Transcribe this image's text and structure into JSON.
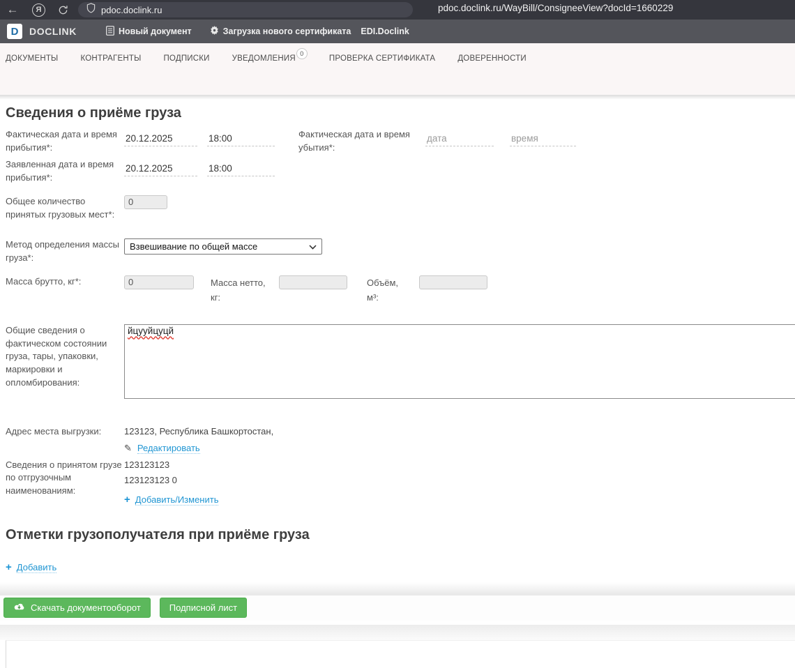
{
  "browser": {
    "url_domain": "pdoc.doclink.ru",
    "url_full": "pdoc.doclink.ru/WayBill/ConsigneeView?docId=1660229"
  },
  "header": {
    "brand": "DOCLINK",
    "logo_letter": "D",
    "menu": [
      {
        "label": "Новый документ"
      },
      {
        "label": "Загрузка нового сертификата"
      },
      {
        "label": "EDI.Doclink"
      }
    ]
  },
  "nav": {
    "tabs": [
      "ДОКУМЕНТЫ",
      "КОНТРАГЕНТЫ",
      "ПОДПИСКИ",
      "УВЕДОМЛЕНИЯ",
      "ПРОВЕРКА СЕРТИФИКАТА",
      "ДОВЕРЕННОСТИ"
    ],
    "notifications_badge": "0"
  },
  "cargo_section": {
    "title": "Сведения о приёме груза",
    "arrival_actual": {
      "label": "Фактическая дата и время прибытия*:",
      "date": "20.12.2025",
      "time": "18:00"
    },
    "departure_actual": {
      "label": "Фактическая дата и время убытия*:",
      "date_placeholder": "дата",
      "time_placeholder": "время"
    },
    "arrival_declared": {
      "label": "Заявленная дата и время прибытия*:",
      "date": "20.12.2025",
      "time": "18:00"
    },
    "total_places": {
      "label": "Общее количество принятых грузовых мест*:",
      "value": "0"
    },
    "mass_method": {
      "label": "Метод определения массы груза*:",
      "selected": "Взвешивание по общей массе"
    },
    "gross_mass": {
      "label": "Масса брутто, кг*:",
      "value": "0"
    },
    "net_mass": {
      "label": "Масса нетто, кг:",
      "value": ""
    },
    "volume": {
      "label": "Объём, м³:",
      "value": ""
    },
    "condition": {
      "label": "Общие сведения о фактическом состоянии груза, тары, упаковки, маркировки и опломбирования:",
      "value": "йцууйцуцй"
    },
    "unload_address": {
      "label": "Адрес места выгрузки:",
      "value": "123123, Республика Башкортостан,",
      "edit_link": "Редактировать"
    },
    "accepted_cargo": {
      "label": "Сведения о принятом грузе по отгрузочным наименованиям:",
      "lines": [
        "123123123",
        "123123123 0"
      ],
      "link": "Добавить/Изменить"
    }
  },
  "marks_section": {
    "title": "Отметки грузополучателя при приёме груза",
    "add_link": "Добавить"
  },
  "footer": {
    "buttons": [
      {
        "label": "Скачать документооборот"
      },
      {
        "label": "Подписной лист"
      }
    ]
  },
  "colors": {
    "link_blue": "#2196d3",
    "button_green": "#5cb85c",
    "header_gray": "#54555b",
    "browser_dark": "#35363d"
  }
}
